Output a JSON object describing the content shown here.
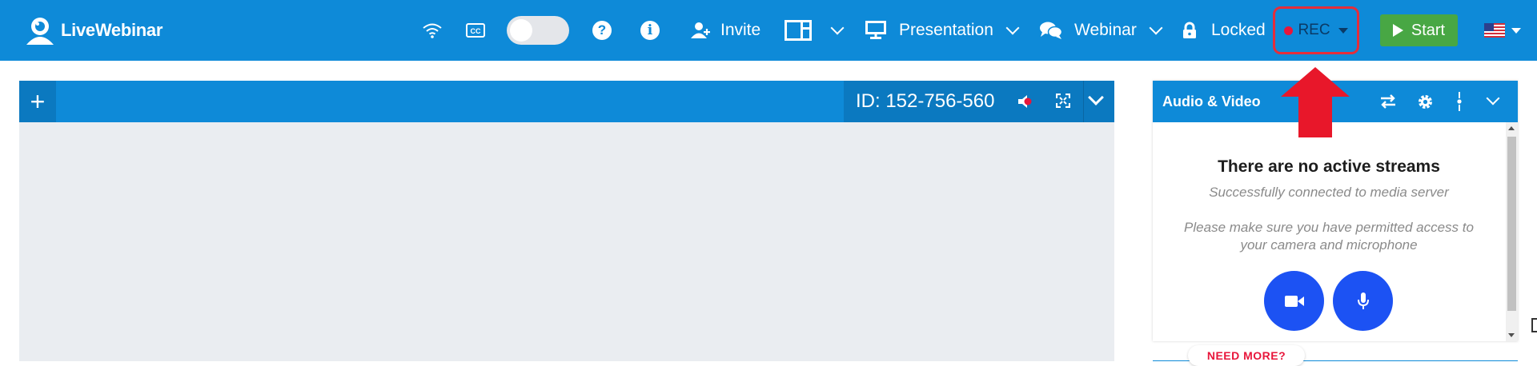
{
  "header": {
    "logo_text": "LiveWebinar",
    "invite_label": "Invite",
    "presentation_label": "Presentation",
    "webinar_label": "Webinar",
    "locked_label": "Locked",
    "rec_label": "REC",
    "start_label": "Start",
    "language": "en-US"
  },
  "stage": {
    "room_id": "ID: 152-756-560"
  },
  "av_panel": {
    "title": "Audio & Video",
    "no_streams_title": "There are no active streams",
    "connected_text": "Successfully connected to media server",
    "permission_text": "Please make sure you have permitted access to your camera and microphone"
  },
  "footer": {
    "need_more_label": "NEED MORE?"
  },
  "colors": {
    "primary_blue": "#0e8ad8",
    "header_dark_blue": "#0b79c0",
    "start_green": "#48a744",
    "rec_red": "#e8163b",
    "annotation_red": "#e52d3a",
    "media_button_blue": "#1c52f3",
    "stage_bg": "#eaedf1"
  }
}
